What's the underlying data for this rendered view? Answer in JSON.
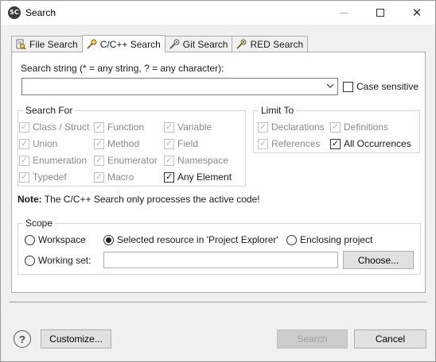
{
  "window": {
    "app_icon_text": "SC",
    "title": "Search"
  },
  "tabs": [
    {
      "label": "File Search",
      "icon": "file-search-icon",
      "active": false
    },
    {
      "label": "C/C++ Search",
      "icon": "cpp-search-icon",
      "active": true
    },
    {
      "label": "Git Search",
      "icon": "git-search-icon",
      "active": false
    },
    {
      "label": "RED Search",
      "icon": "red-search-icon",
      "active": false
    }
  ],
  "search_string": {
    "label": "Search string (* = any string, ? = any character):",
    "value": "",
    "case_sensitive_label": "Case sensitive",
    "case_sensitive_checked": false
  },
  "search_for": {
    "title": "Search For",
    "items": [
      {
        "label": "Class / Struct",
        "checked": true,
        "enabled": false
      },
      {
        "label": "Function",
        "checked": true,
        "enabled": false
      },
      {
        "label": "Variable",
        "checked": true,
        "enabled": false
      },
      {
        "label": "Union",
        "checked": true,
        "enabled": false
      },
      {
        "label": "Method",
        "checked": true,
        "enabled": false
      },
      {
        "label": "Field",
        "checked": true,
        "enabled": false
      },
      {
        "label": "Enumeration",
        "checked": true,
        "enabled": false
      },
      {
        "label": "Enumerator",
        "checked": true,
        "enabled": false
      },
      {
        "label": "Namespace",
        "checked": true,
        "enabled": false
      },
      {
        "label": "Typedef",
        "checked": true,
        "enabled": false
      },
      {
        "label": "Macro",
        "checked": true,
        "enabled": false
      },
      {
        "label": "Any Element",
        "checked": true,
        "enabled": true
      }
    ]
  },
  "limit_to": {
    "title": "Limit To",
    "items": [
      {
        "label": "Declarations",
        "checked": true,
        "enabled": false
      },
      {
        "label": "Definitions",
        "checked": true,
        "enabled": false
      },
      {
        "label": "References",
        "checked": true,
        "enabled": false
      },
      {
        "label": "All Occurrences",
        "checked": true,
        "enabled": true
      }
    ]
  },
  "note": {
    "bold": "Note:",
    "text": "The C/C++ Search only processes the active code!"
  },
  "scope": {
    "title": "Scope",
    "workspace": "Workspace",
    "selected_resource": "Selected resource in 'Project Explorer'",
    "enclosing_project": "Enclosing project",
    "working_set": "Working set:",
    "working_set_value": "",
    "choose_label": "Choose...",
    "selected": "selected_resource"
  },
  "footer": {
    "help": "?",
    "customize_label": "Customize...",
    "search_label": "Search",
    "cancel_label": "Cancel"
  }
}
